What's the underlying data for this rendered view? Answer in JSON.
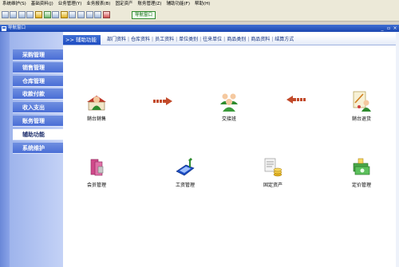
{
  "menu": [
    "系统维护(S)",
    "基础资料(J)",
    "业务管理(Y)",
    "业务报表(B)",
    "固定资产",
    "账务管理(Z)",
    "辅助功能(F)",
    "帮助(H)"
  ],
  "toolbar": {
    "nav_button": "导航窗口"
  },
  "window": {
    "title": "导航窗口"
  },
  "sidebar": {
    "items": [
      "采购管理",
      "销售管理",
      "仓库管理",
      "收款付款",
      "收入支出",
      "账务管理",
      "辅助功能",
      "系统维护"
    ],
    "active": "辅助功能"
  },
  "tabs": {
    "active": ">> 辅助功能",
    "links": [
      "部门资料",
      "仓库资料",
      "员工资料",
      "单位类别",
      "往来单位",
      "商品类别",
      "商品资料",
      "结算方式"
    ]
  },
  "functions": [
    {
      "label": "銷台銷售",
      "icon": "person-shop-icon"
    },
    {
      "label": "交接班",
      "icon": "people-group-icon"
    },
    {
      "label": "銷台退货",
      "icon": "document-person-icon"
    },
    {
      "label": "会员管理",
      "icon": "member-book-icon"
    },
    {
      "label": "工资管理",
      "icon": "salary-keyboard-icon"
    },
    {
      "label": "固定资产",
      "icon": "coins-icon"
    },
    {
      "label": "定价管理",
      "icon": "price-money-icon"
    }
  ],
  "colors": {
    "accent": "#1d4cc2",
    "sidebar": "#4a6ed6",
    "arrow": "#c24a2a"
  }
}
